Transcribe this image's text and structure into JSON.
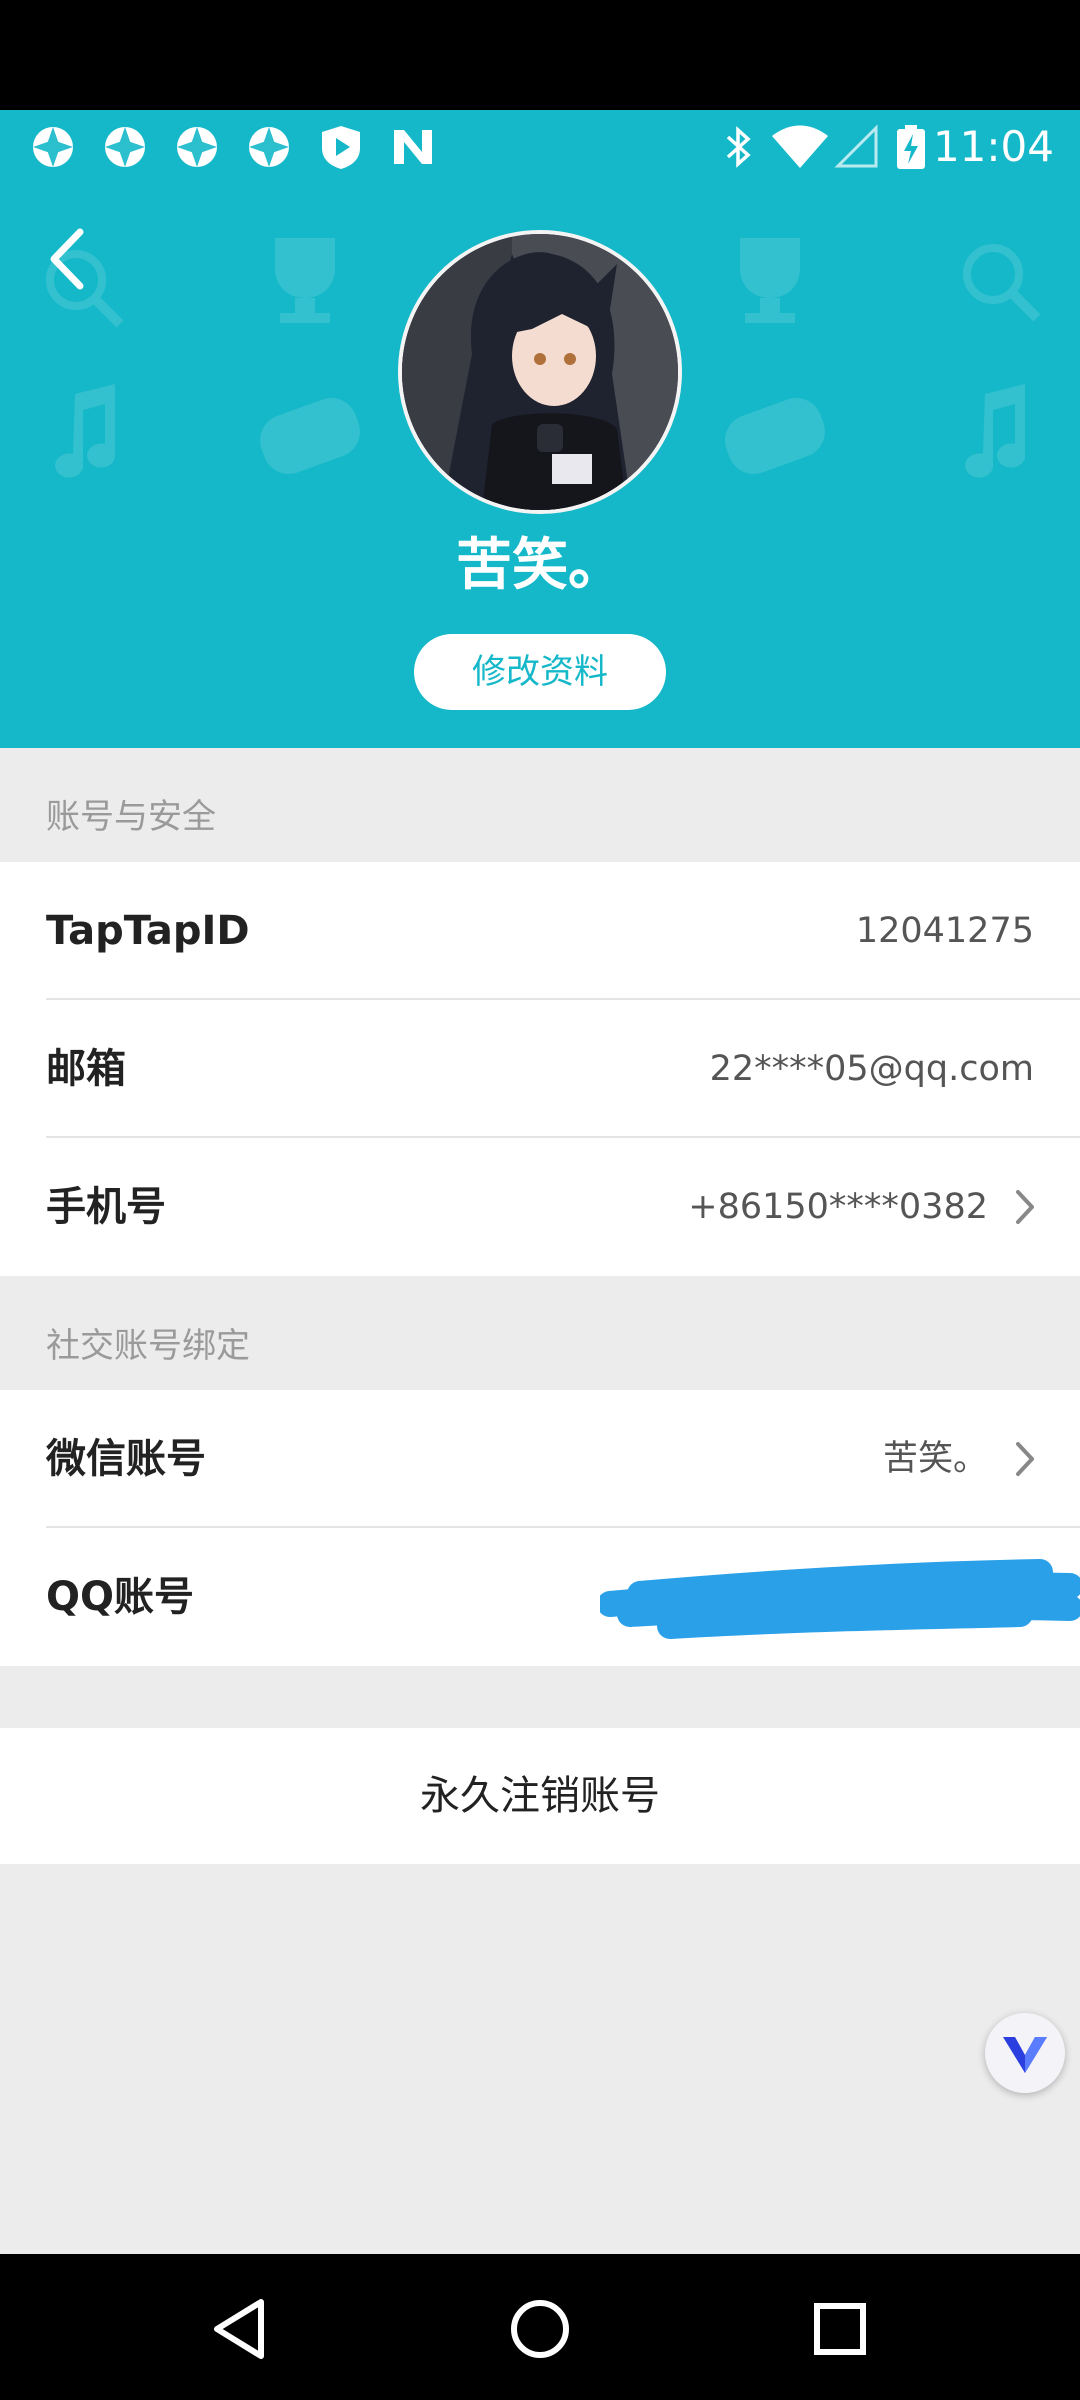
{
  "status_bar": {
    "time": "11:04",
    "left_icons": [
      "app-notification-icon",
      "app-notification-icon",
      "app-notification-icon",
      "app-notification-icon",
      "play-shield-icon",
      "n-logo-icon"
    ],
    "right_icons": [
      "bluetooth-icon",
      "wifi-icon",
      "cell-signal-icon",
      "battery-charging-icon"
    ]
  },
  "header": {
    "nickname": "苦笑。",
    "edit_button": "修改资料",
    "accent_color": "#15b8c8"
  },
  "account_security": {
    "section_label": "账号与安全",
    "rows": [
      {
        "label": "TapTapID",
        "value": "12041275"
      },
      {
        "label": "邮箱",
        "value": "22****05@qq.com"
      },
      {
        "label": "手机号",
        "value": "+86150****0382"
      }
    ]
  },
  "social_binding": {
    "section_label": "社交账号绑定",
    "rows": [
      {
        "label": "微信账号",
        "value": "苦笑。"
      },
      {
        "label": "QQ账号",
        "value": ""
      }
    ]
  },
  "delete_account": "永久注销账号",
  "nav_bar": {
    "icons": [
      "back-triangle-icon",
      "home-circle-icon",
      "recents-square-icon"
    ]
  }
}
